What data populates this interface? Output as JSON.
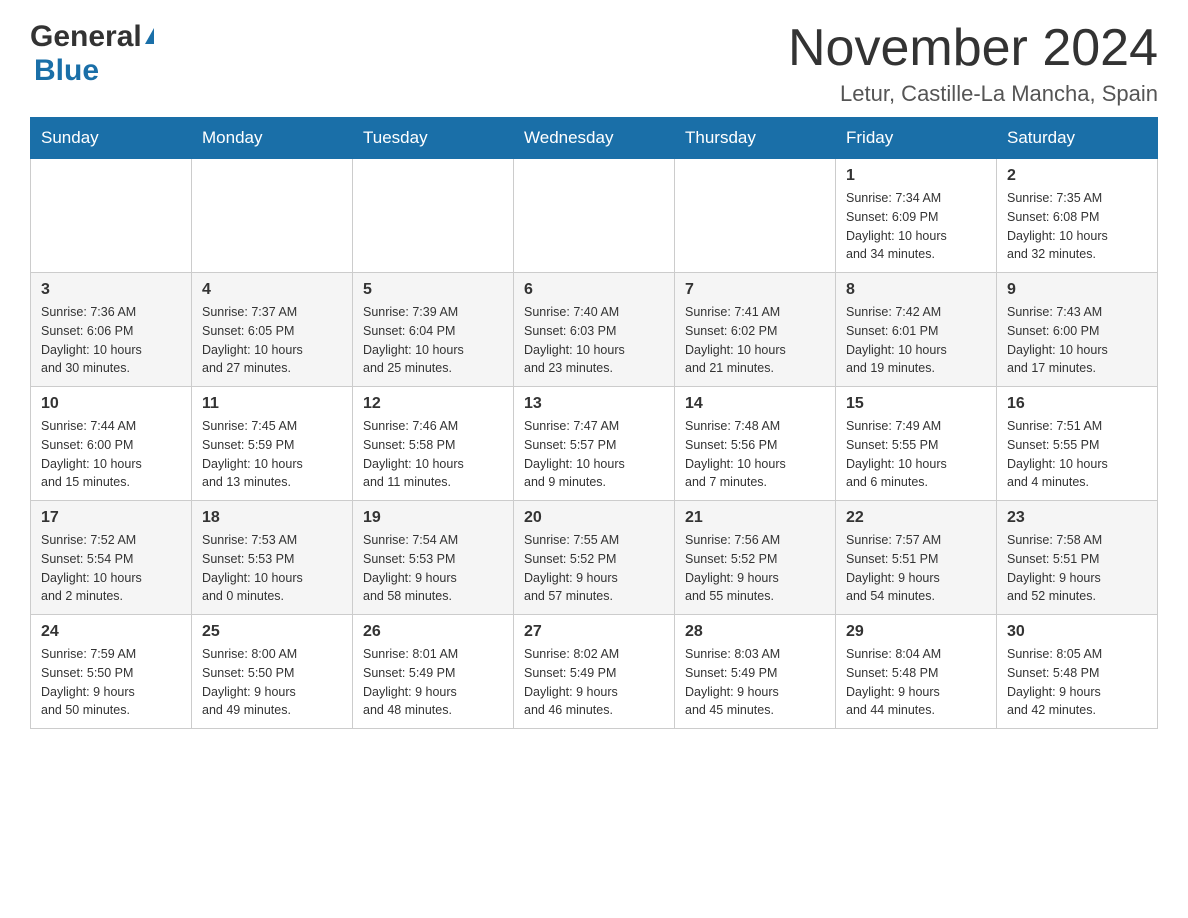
{
  "header": {
    "logo_general": "General",
    "logo_blue": "Blue",
    "month_title": "November 2024",
    "location": "Letur, Castille-La Mancha, Spain"
  },
  "days_of_week": [
    "Sunday",
    "Monday",
    "Tuesday",
    "Wednesday",
    "Thursday",
    "Friday",
    "Saturday"
  ],
  "weeks": [
    [
      {
        "day": "",
        "info": ""
      },
      {
        "day": "",
        "info": ""
      },
      {
        "day": "",
        "info": ""
      },
      {
        "day": "",
        "info": ""
      },
      {
        "day": "",
        "info": ""
      },
      {
        "day": "1",
        "info": "Sunrise: 7:34 AM\nSunset: 6:09 PM\nDaylight: 10 hours\nand 34 minutes."
      },
      {
        "day": "2",
        "info": "Sunrise: 7:35 AM\nSunset: 6:08 PM\nDaylight: 10 hours\nand 32 minutes."
      }
    ],
    [
      {
        "day": "3",
        "info": "Sunrise: 7:36 AM\nSunset: 6:06 PM\nDaylight: 10 hours\nand 30 minutes."
      },
      {
        "day": "4",
        "info": "Sunrise: 7:37 AM\nSunset: 6:05 PM\nDaylight: 10 hours\nand 27 minutes."
      },
      {
        "day": "5",
        "info": "Sunrise: 7:39 AM\nSunset: 6:04 PM\nDaylight: 10 hours\nand 25 minutes."
      },
      {
        "day": "6",
        "info": "Sunrise: 7:40 AM\nSunset: 6:03 PM\nDaylight: 10 hours\nand 23 minutes."
      },
      {
        "day": "7",
        "info": "Sunrise: 7:41 AM\nSunset: 6:02 PM\nDaylight: 10 hours\nand 21 minutes."
      },
      {
        "day": "8",
        "info": "Sunrise: 7:42 AM\nSunset: 6:01 PM\nDaylight: 10 hours\nand 19 minutes."
      },
      {
        "day": "9",
        "info": "Sunrise: 7:43 AM\nSunset: 6:00 PM\nDaylight: 10 hours\nand 17 minutes."
      }
    ],
    [
      {
        "day": "10",
        "info": "Sunrise: 7:44 AM\nSunset: 6:00 PM\nDaylight: 10 hours\nand 15 minutes."
      },
      {
        "day": "11",
        "info": "Sunrise: 7:45 AM\nSunset: 5:59 PM\nDaylight: 10 hours\nand 13 minutes."
      },
      {
        "day": "12",
        "info": "Sunrise: 7:46 AM\nSunset: 5:58 PM\nDaylight: 10 hours\nand 11 minutes."
      },
      {
        "day": "13",
        "info": "Sunrise: 7:47 AM\nSunset: 5:57 PM\nDaylight: 10 hours\nand 9 minutes."
      },
      {
        "day": "14",
        "info": "Sunrise: 7:48 AM\nSunset: 5:56 PM\nDaylight: 10 hours\nand 7 minutes."
      },
      {
        "day": "15",
        "info": "Sunrise: 7:49 AM\nSunset: 5:55 PM\nDaylight: 10 hours\nand 6 minutes."
      },
      {
        "day": "16",
        "info": "Sunrise: 7:51 AM\nSunset: 5:55 PM\nDaylight: 10 hours\nand 4 minutes."
      }
    ],
    [
      {
        "day": "17",
        "info": "Sunrise: 7:52 AM\nSunset: 5:54 PM\nDaylight: 10 hours\nand 2 minutes."
      },
      {
        "day": "18",
        "info": "Sunrise: 7:53 AM\nSunset: 5:53 PM\nDaylight: 10 hours\nand 0 minutes."
      },
      {
        "day": "19",
        "info": "Sunrise: 7:54 AM\nSunset: 5:53 PM\nDaylight: 9 hours\nand 58 minutes."
      },
      {
        "day": "20",
        "info": "Sunrise: 7:55 AM\nSunset: 5:52 PM\nDaylight: 9 hours\nand 57 minutes."
      },
      {
        "day": "21",
        "info": "Sunrise: 7:56 AM\nSunset: 5:52 PM\nDaylight: 9 hours\nand 55 minutes."
      },
      {
        "day": "22",
        "info": "Sunrise: 7:57 AM\nSunset: 5:51 PM\nDaylight: 9 hours\nand 54 minutes."
      },
      {
        "day": "23",
        "info": "Sunrise: 7:58 AM\nSunset: 5:51 PM\nDaylight: 9 hours\nand 52 minutes."
      }
    ],
    [
      {
        "day": "24",
        "info": "Sunrise: 7:59 AM\nSunset: 5:50 PM\nDaylight: 9 hours\nand 50 minutes."
      },
      {
        "day": "25",
        "info": "Sunrise: 8:00 AM\nSunset: 5:50 PM\nDaylight: 9 hours\nand 49 minutes."
      },
      {
        "day": "26",
        "info": "Sunrise: 8:01 AM\nSunset: 5:49 PM\nDaylight: 9 hours\nand 48 minutes."
      },
      {
        "day": "27",
        "info": "Sunrise: 8:02 AM\nSunset: 5:49 PM\nDaylight: 9 hours\nand 46 minutes."
      },
      {
        "day": "28",
        "info": "Sunrise: 8:03 AM\nSunset: 5:49 PM\nDaylight: 9 hours\nand 45 minutes."
      },
      {
        "day": "29",
        "info": "Sunrise: 8:04 AM\nSunset: 5:48 PM\nDaylight: 9 hours\nand 44 minutes."
      },
      {
        "day": "30",
        "info": "Sunrise: 8:05 AM\nSunset: 5:48 PM\nDaylight: 9 hours\nand 42 minutes."
      }
    ]
  ]
}
